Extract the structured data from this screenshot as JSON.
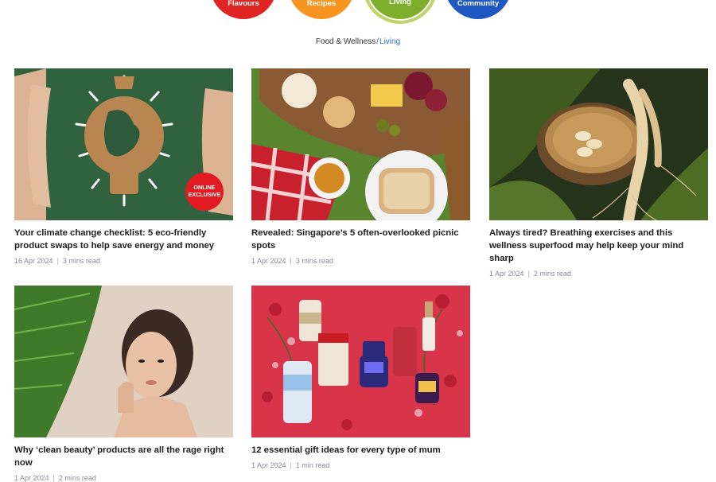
{
  "categories": [
    {
      "label": "Flavours",
      "color": "#e02424"
    },
    {
      "label": "Recipes",
      "color": "#f7941d"
    },
    {
      "label": "Living",
      "color": "#7dae2c"
    },
    {
      "label": "Community",
      "color": "#1f57c3"
    }
  ],
  "breadcrumb": {
    "parent": "Food & Wellness",
    "separator": "/",
    "current": "Living"
  },
  "articles": [
    {
      "title": "Your climate change checklist: 5 eco-friendly product swaps to help save energy and money",
      "date": "16 Apr 2024",
      "read_time": "3 mins read",
      "badge": [
        "ONLINE",
        "EXCLUSIVE"
      ]
    },
    {
      "title": "Revealed: Singapore’s 5 often-overlooked picnic spots",
      "date": "1 Apr 2024",
      "read_time": "3 mins read"
    },
    {
      "title": "Always tired? Breathing exercises and this wellness superfood may help keep your mind sharp",
      "date": "1 Apr 2024",
      "read_time": "2 mins read"
    },
    {
      "title": "Why ‘clean beauty’ products are all the rage right now",
      "date": "1 Apr 2024",
      "read_time": "2 mins read"
    },
    {
      "title": "12 essential gift ideas for every type of mum",
      "date": "1 Apr 2024",
      "read_time": "1 min read"
    }
  ],
  "meta_divider": "|",
  "colors": {
    "link_active": "#2a6fd6",
    "badge_red": "#e21b23",
    "meta_grey": "#8a8a99"
  }
}
